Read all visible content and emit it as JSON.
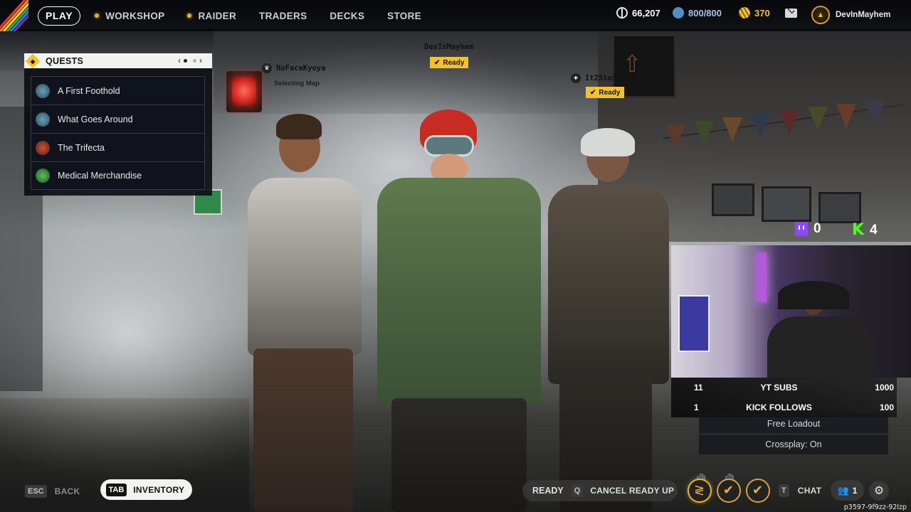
{
  "nav": {
    "play": "PLAY",
    "items": [
      {
        "label": "WORKSHOP",
        "dot": true
      },
      {
        "label": "RAIDER",
        "dot": true
      },
      {
        "label": "TRADERS",
        "dot": false
      },
      {
        "label": "DECKS",
        "dot": false
      },
      {
        "label": "STORE",
        "dot": false
      }
    ]
  },
  "currency": {
    "coins": "66,207",
    "raider_tokens": "800/800",
    "cred": "370"
  },
  "user": {
    "name": "DevInMayhem"
  },
  "quests": {
    "title": "QUESTS",
    "items": [
      {
        "label": "A First Foothold"
      },
      {
        "label": "What Goes Around"
      },
      {
        "label": "The Trifecta"
      },
      {
        "label": "Medical Merchandise"
      }
    ]
  },
  "players": {
    "left": {
      "name": "NoFaceKyoya",
      "status": "Selecting Map"
    },
    "center": {
      "name": "DevInMayhem",
      "status": "Ready"
    },
    "right": {
      "name": "It2StainTTV",
      "status": "Ready"
    }
  },
  "stream": {
    "twitch_count": "0",
    "kick_count": "4",
    "goals": [
      {
        "left": "11",
        "label": "YT SUBS",
        "right": "1000"
      },
      {
        "left": "1",
        "label": "KICK FOLLOWS",
        "right": "100"
      }
    ]
  },
  "lobby_info": {
    "loadout": "Free Loadout",
    "crossplay": "Crossplay: On"
  },
  "bottom": {
    "esc_key": "ESC",
    "back": "BACK",
    "tab_key": "TAB",
    "inventory": "INVENTORY",
    "ready": "READY",
    "q_key": "Q",
    "cancel_ready": "CANCEL READY UP",
    "t_key": "T",
    "chat": "CHAT",
    "party_count": "1"
  },
  "session_id": "p3597-9f9zz-92lzp",
  "colors": {
    "accent_yellow": "#f3c12b",
    "twitch": "#9146ff",
    "kick": "#53fc18"
  }
}
